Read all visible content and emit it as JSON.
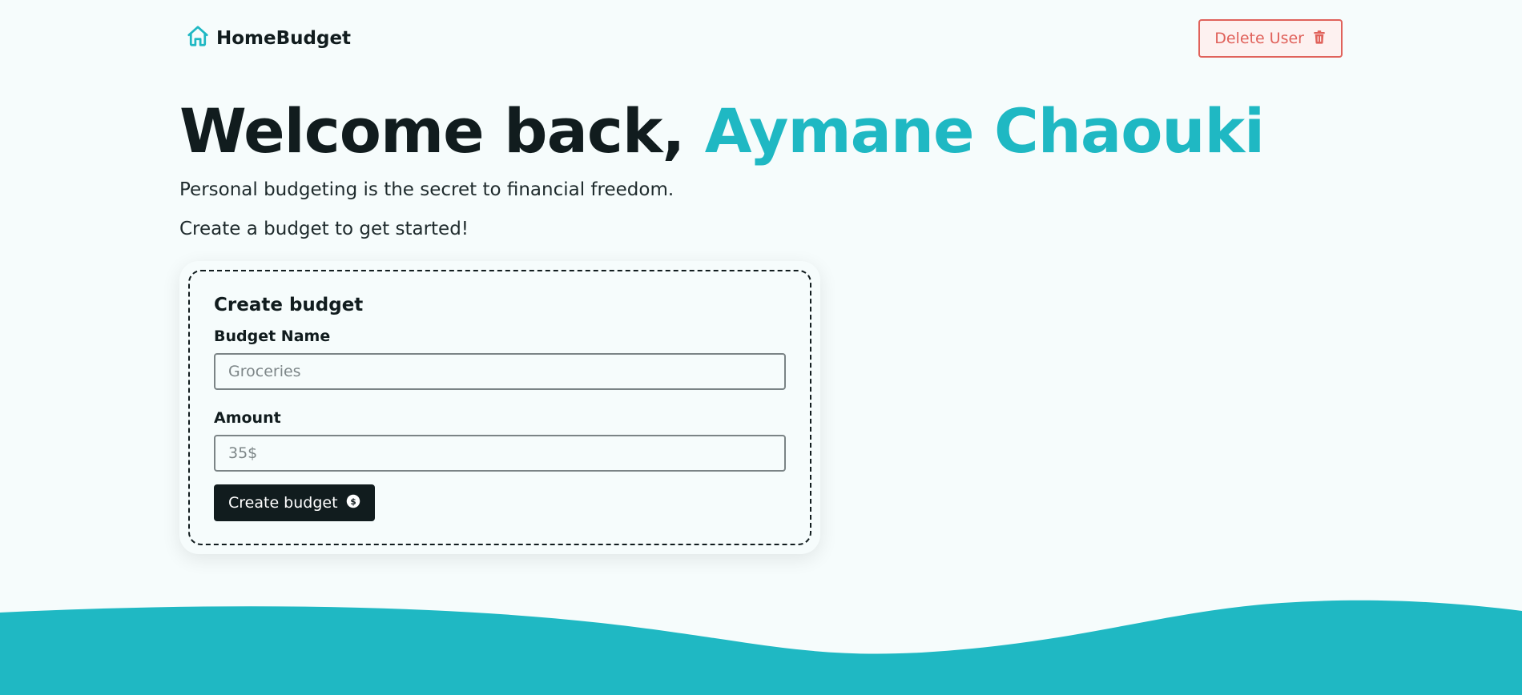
{
  "brand": {
    "name": "HomeBudget",
    "icon": "home-icon",
    "accent_color": "#1fb8c3"
  },
  "header": {
    "delete_user_label": "Delete User",
    "delete_icon": "trash-icon"
  },
  "hero": {
    "greeting": "Welcome back, ",
    "user_name": "Aymane Chaouki",
    "tagline": "Personal budgeting is the secret to financial freedom.",
    "prompt": "Create a budget to get started!"
  },
  "create_budget_form": {
    "title": "Create budget",
    "budget_name_label": "Budget Name",
    "budget_name_placeholder": "Groceries",
    "budget_name_value": "",
    "amount_label": "Amount",
    "amount_placeholder": "35$",
    "amount_value": "",
    "submit_label": "Create budget",
    "submit_icon": "dollar-circle-icon"
  },
  "colors": {
    "background": "#f6fcfc",
    "text": "#111c1e",
    "accent": "#1fb8c3",
    "danger": "#e0625b"
  }
}
